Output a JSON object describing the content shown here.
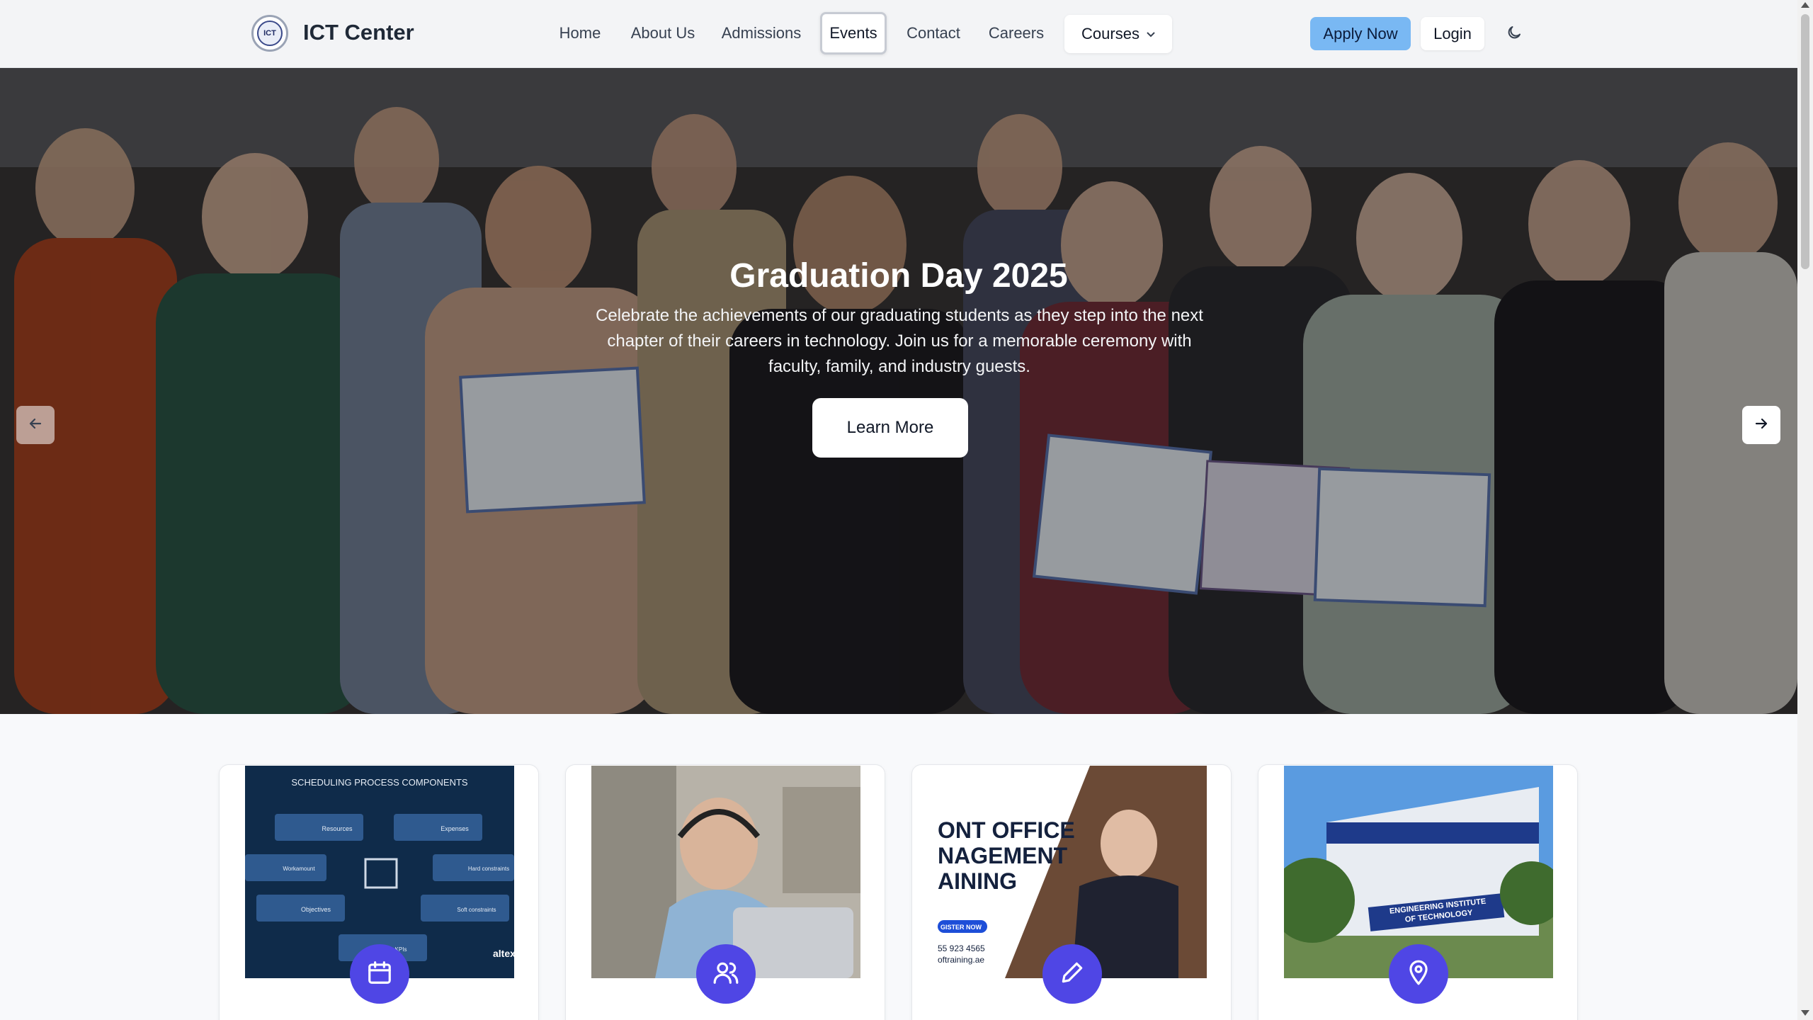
{
  "header": {
    "brand": "ICT Center",
    "logo_text": "ICT",
    "nav": [
      "Home",
      "About Us",
      "Admissions",
      "Events",
      "Contact",
      "Careers",
      "Courses"
    ],
    "active_nav": "Events",
    "apply_label": "Apply Now",
    "login_label": "Login",
    "theme_icon": "moon-icon"
  },
  "hero": {
    "title": "Graduation Day 2025",
    "description": "Celebrate the achievements of our graduating students as they step into the next chapter of their careers in technology. Join us for a memorable ceremony with faculty, family, and industry guests.",
    "button_label": "Learn More",
    "prev_icon": "arrow-left-icon",
    "next_icon": "arrow-right-icon"
  },
  "cards": [
    {
      "icon": "calendar-icon",
      "image_heading": "SCHEDULING PROCESS COMPONENTS",
      "image_labels": [
        "Resources",
        "Expenses",
        "Workamount",
        "Hard constraints",
        "Objectives",
        "Soft constraints",
        "KPIs"
      ],
      "image_brand": "altex"
    },
    {
      "icon": "users-icon"
    },
    {
      "icon": "pencil-icon",
      "image_lines": [
        "ONT OFFICE",
        "NAGEMENT",
        "AINING"
      ],
      "image_cta": "GISTER NOW",
      "image_contact": [
        "55 923 4565",
        "oftraining.ae"
      ]
    },
    {
      "icon": "map-pin-icon",
      "image_sign": [
        "ENGINEERING INSTITUTE",
        "OF TECHNOLOGY"
      ]
    }
  ],
  "colors": {
    "accent": "#4f46e5",
    "apply_bg": "#79b8f3",
    "header_bg": "#f3f4f6"
  }
}
